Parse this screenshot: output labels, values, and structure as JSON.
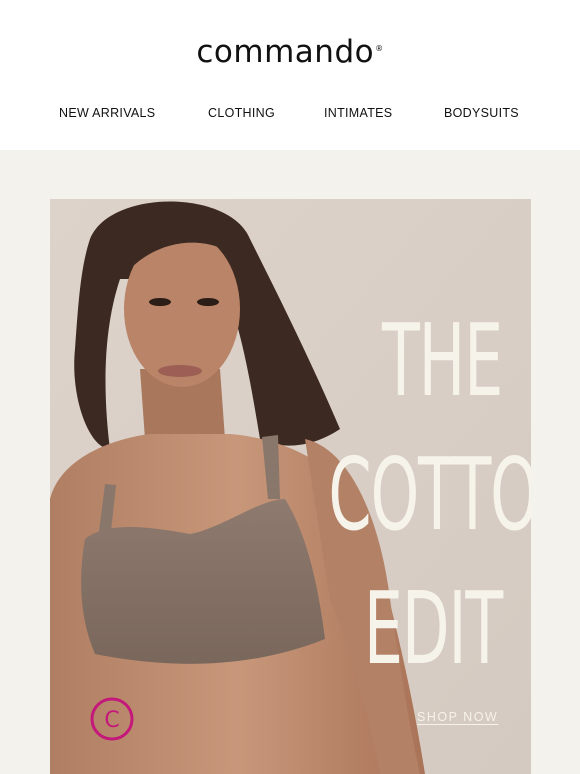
{
  "brand": {
    "name": "commando",
    "registered_mark": "®"
  },
  "nav": {
    "items": [
      {
        "label": "NEW ARRIVALS"
      },
      {
        "label": "CLOTHING"
      },
      {
        "label": "INTIMATES"
      },
      {
        "label": "BODYSUITS"
      }
    ]
  },
  "hero": {
    "headline_lines": [
      "THE",
      "COTTON",
      "EDIT"
    ],
    "cta_label": "SHOP NOW",
    "badge_letter": "C",
    "colors": {
      "section_background": "#f4f2ec",
      "photo_background": "#ddd4cc",
      "headline_text": "#f6f3ea",
      "badge_accent": "#c4187a"
    }
  }
}
